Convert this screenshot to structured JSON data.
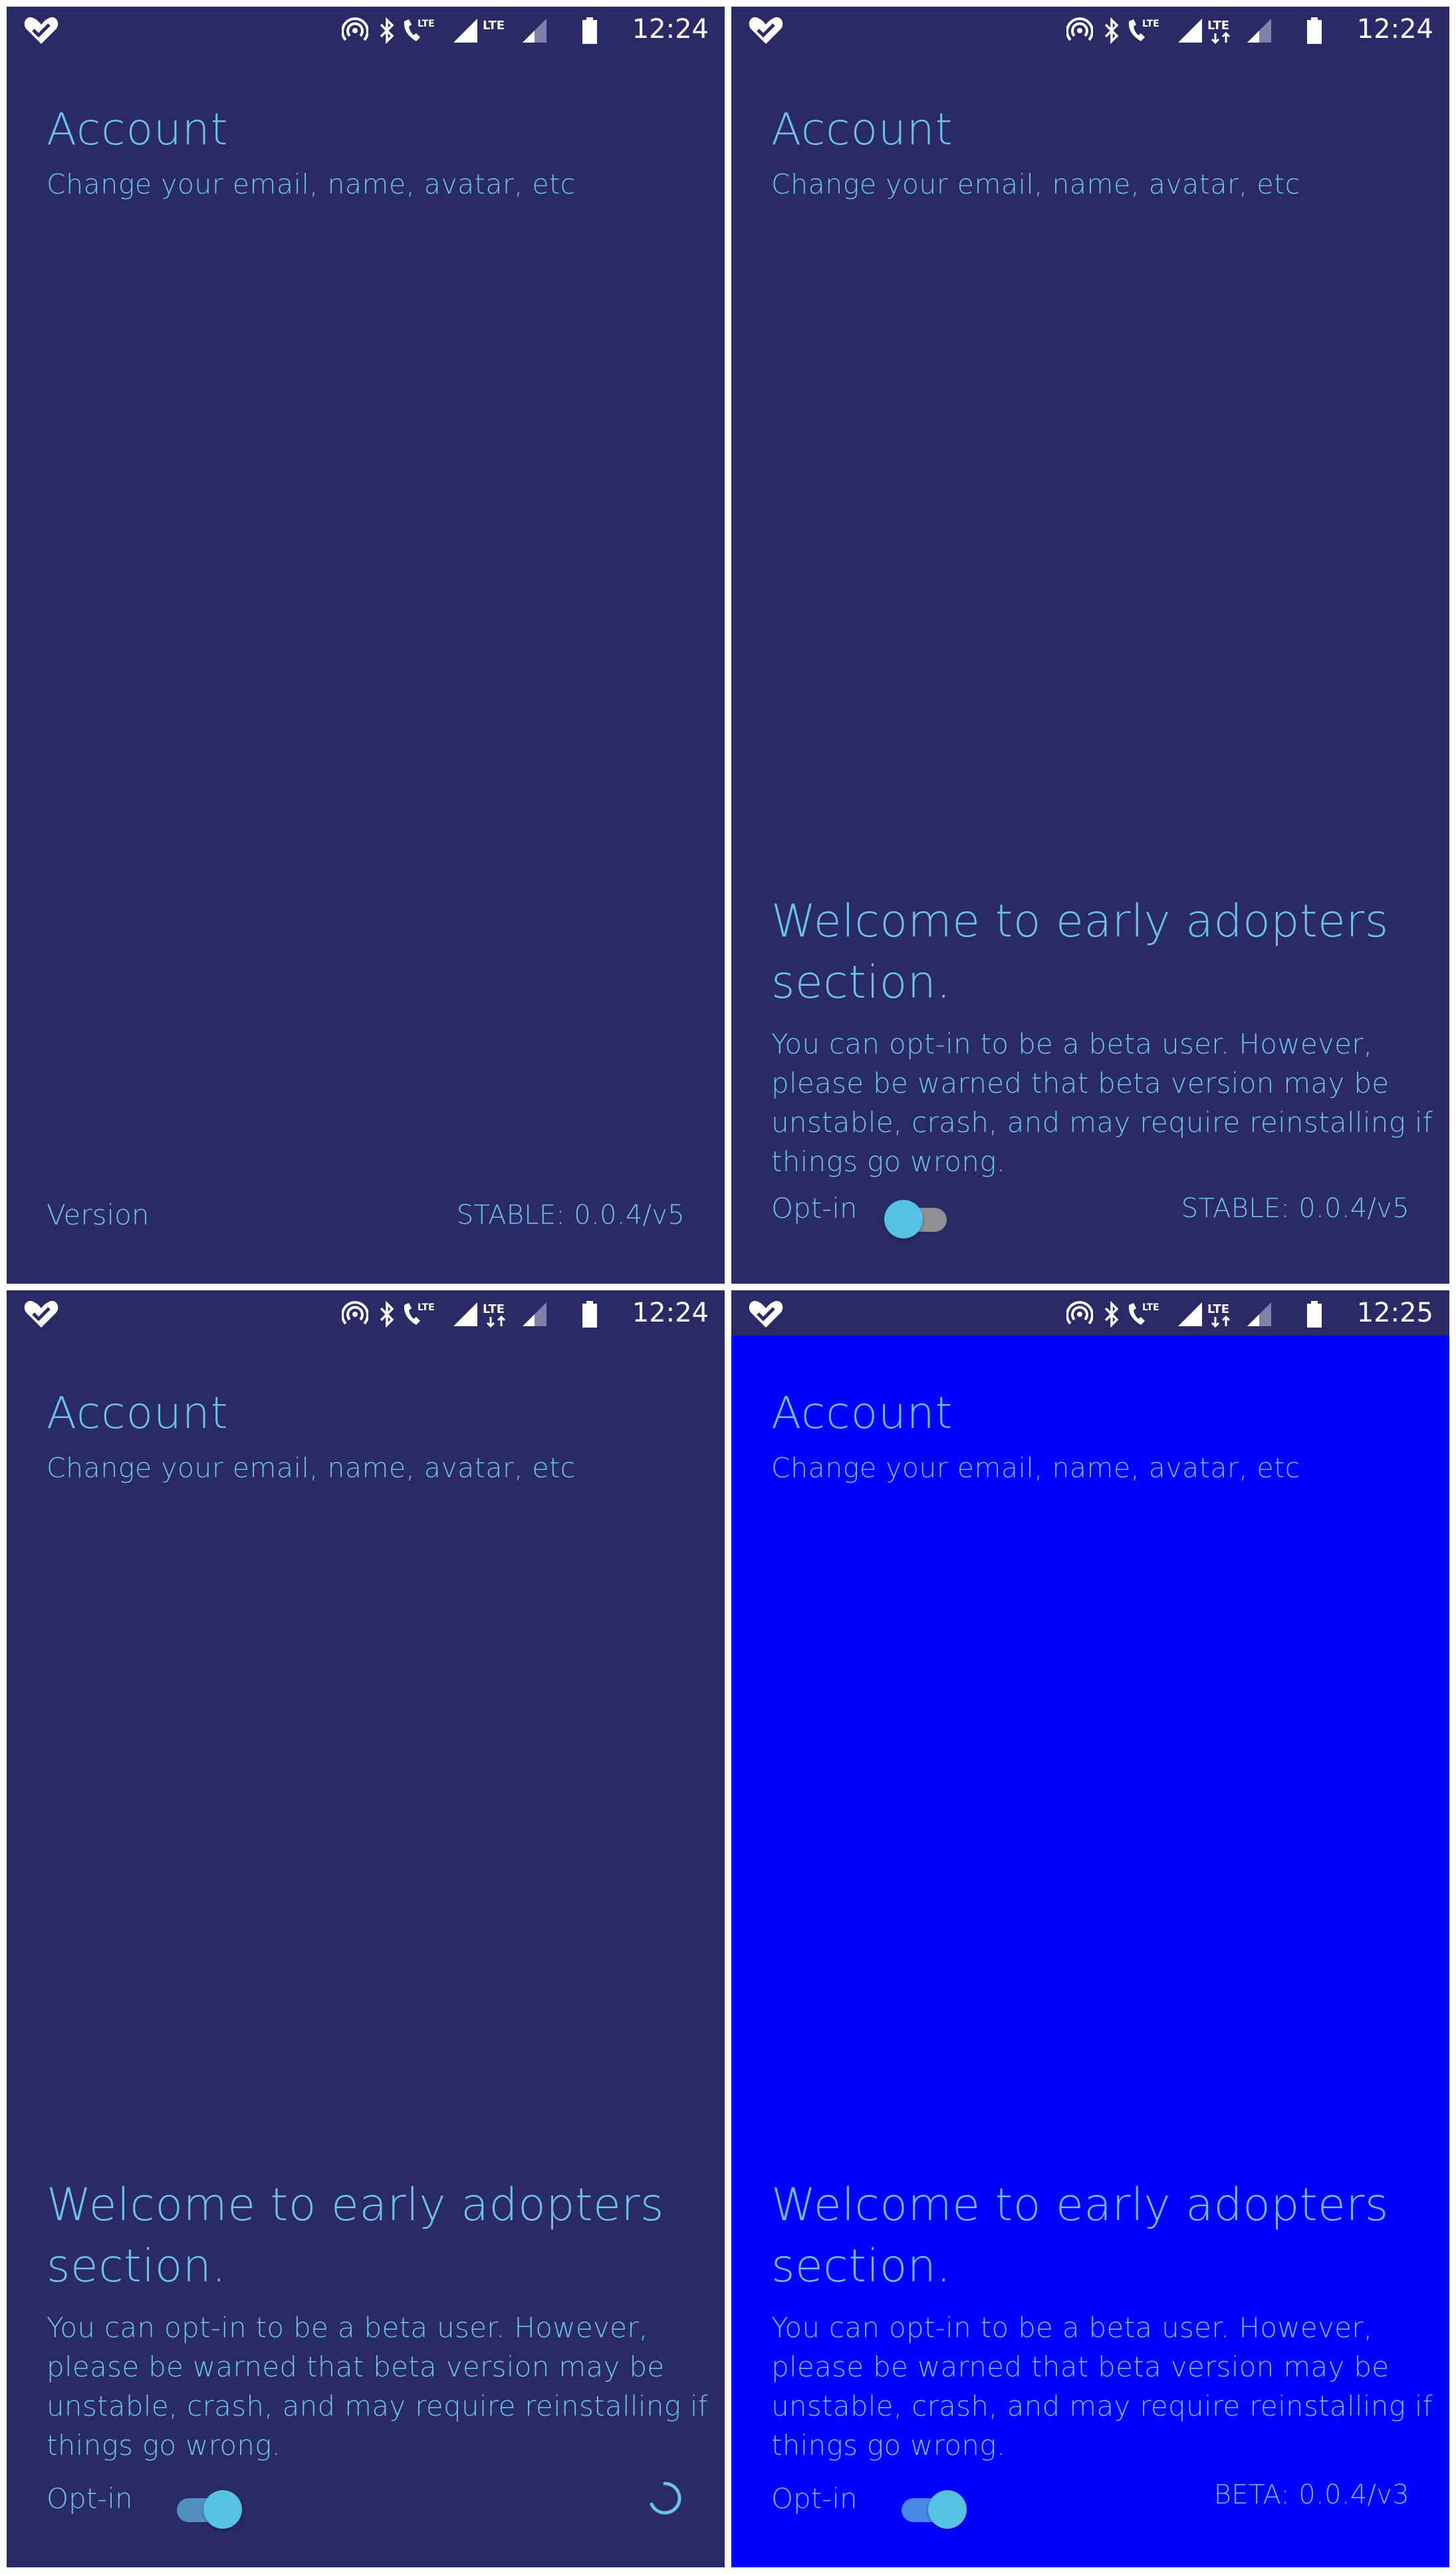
{
  "panels": [
    {
      "status": {
        "time": "12:24"
      },
      "title": "Account",
      "subtitle": "Change your email, name, avatar, etc",
      "version_label": "Version",
      "version_value": "STABLE: 0.0.4/v5"
    },
    {
      "status": {
        "time": "12:24"
      },
      "title": "Account",
      "subtitle": "Change your email, name, avatar, etc",
      "welcome": "Welcome to early adopters section.",
      "description": "You can opt-in to be a beta user. However, please be warned that beta version may be unstable, crash, and may require reinstalling if things go wrong.",
      "optin_label": "Opt-in",
      "optin_state": "off",
      "version_value": "STABLE: 0.0.4/v5"
    },
    {
      "status": {
        "time": "12:24"
      },
      "title": "Account",
      "subtitle": "Change your email, name, avatar, etc",
      "welcome": "Welcome to early adopters section.",
      "description": "You can opt-in to be a beta user. However, please be warned that beta version may be unstable, crash, and may require reinstalling if things go wrong.",
      "optin_label": "Opt-in",
      "optin_state": "on",
      "loading": true
    },
    {
      "status": {
        "time": "12:25"
      },
      "title": "Account",
      "subtitle": "Change your email, name, avatar, etc",
      "welcome": "Welcome to early adopters section.",
      "description": "You can opt-in to be a beta user. However, please be warned that beta version may be unstable, crash, and may require reinstalling if things go wrong.",
      "optin_label": "Opt-in",
      "optin_state": "on",
      "version_value": "BETA: 0.0.4/v3"
    }
  ],
  "colors": {
    "background": "#2a2b66",
    "beta_background": "#0000ff",
    "accent_text": "#6cc1ea",
    "toggle_thumb": "#55c2e4",
    "status_text": "#ffffff"
  },
  "icons": [
    "heart-check-icon",
    "hotspot-icon",
    "bluetooth-icon",
    "lte-call-icon",
    "signal-icon",
    "lte-data-icon",
    "signal-weak-icon",
    "battery-icon",
    "loading-spinner-icon"
  ]
}
